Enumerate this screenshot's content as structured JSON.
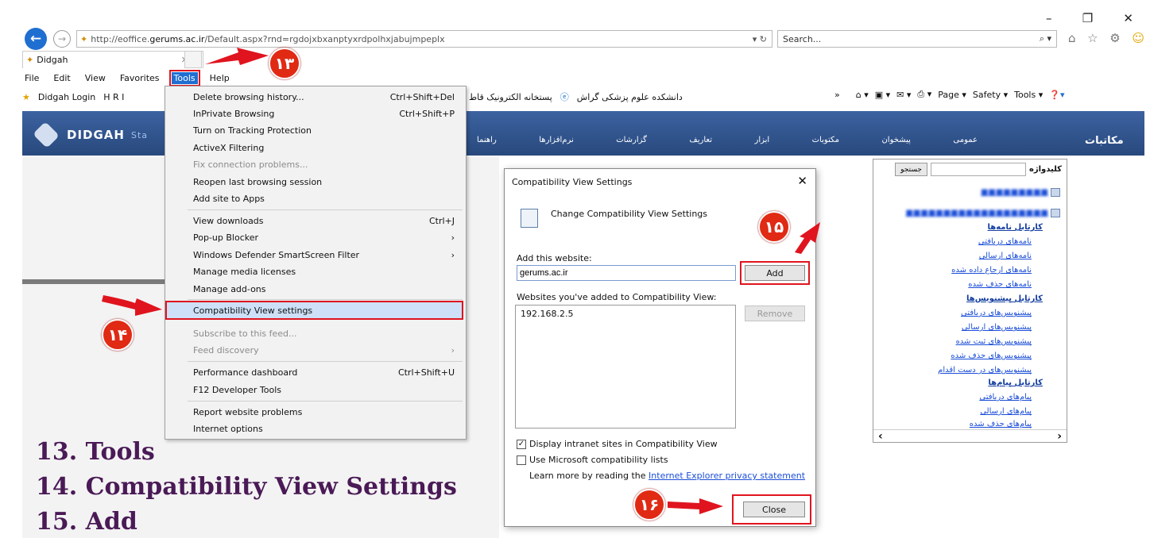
{
  "browser": {
    "url_prefix": "http://eoffice.",
    "url_domain": "gerums.ac.ir",
    "url_rest": "/Default.aspx?rnd=rgdojxbxanptyxrdpolhxjabujmpeplx",
    "search_placeholder": "Search...",
    "tab_title": "Didgah",
    "menu": [
      "File",
      "Edit",
      "View",
      "Favorites",
      "Tools",
      "Help"
    ],
    "favorites": [
      "Didgah Login",
      "H R I"
    ],
    "fav_right": "دانشکده علوم پزشکی گراش",
    "fav_right2": "پستخانه الکترونیک قاط",
    "cmd": [
      "Page ▾",
      "Safety ▾",
      "Tools ▾"
    ]
  },
  "page": {
    "logo": "DIDGAH",
    "logo_suffix": "Sta",
    "nav": [
      "عمومی",
      "پیشخوان",
      "مکتوبات",
      "ابزار",
      "تعاریف",
      "گزارشات",
      "نرم‌افزارها",
      "راهنما"
    ],
    "right_title": "مکاتبات",
    "tree": {
      "keyword_label": "کلیدواژه",
      "search_btn": "جستجو",
      "nodes": [
        {
          "label": "کارتابل نامه‌ها",
          "bold": true
        },
        {
          "label": "نامه‌های دریافتی"
        },
        {
          "label": "نامه‌های ارسالی"
        },
        {
          "label": "نامه‌های ارجاع داده شده"
        },
        {
          "label": "نامه‌های حذف شده"
        },
        {
          "label": "کارتابل پیشنویس‌ها",
          "bold": true
        },
        {
          "label": "پیشنویس‌های دریافتی"
        },
        {
          "label": "پیشنویس‌های ارسالی"
        },
        {
          "label": "پیشنویس‌های ثبت شده"
        },
        {
          "label": "پیشنویس‌های حذف شده"
        },
        {
          "label": "پیشنویس‌های در دست اقدام"
        },
        {
          "label": "کارتابل پیام‌ها",
          "bold": true
        },
        {
          "label": "پیام‌های دریافتی"
        },
        {
          "label": "پیام‌های ارسالی"
        },
        {
          "label": "پیام‌های حذف شده"
        }
      ]
    }
  },
  "tools_menu": [
    {
      "label": "Delete browsing history...",
      "shortcut": "Ctrl+Shift+Del"
    },
    {
      "label": "InPrivate Browsing",
      "shortcut": "Ctrl+Shift+P"
    },
    {
      "label": "Turn on Tracking Protection",
      "shortcut": ""
    },
    {
      "label": "ActiveX Filtering",
      "shortcut": ""
    },
    {
      "label": "Fix connection problems...",
      "shortcut": "",
      "disabled": true
    },
    {
      "label": "Reopen last browsing session",
      "shortcut": ""
    },
    {
      "label": "Add site to Apps",
      "shortcut": ""
    },
    {
      "label": "View downloads",
      "shortcut": "Ctrl+J"
    },
    {
      "label": "Pop-up Blocker",
      "shortcut": "›"
    },
    {
      "label": "Windows Defender SmartScreen Filter",
      "shortcut": "›"
    },
    {
      "label": "Manage media licenses",
      "shortcut": ""
    },
    {
      "label": "Manage add-ons",
      "shortcut": ""
    },
    {
      "label": "Compatibility View settings",
      "shortcut": ""
    },
    {
      "label": "Subscribe to this feed...",
      "shortcut": "",
      "disabled": true
    },
    {
      "label": "Feed discovery",
      "shortcut": "›",
      "disabled": true
    },
    {
      "label": "Performance dashboard",
      "shortcut": "Ctrl+Shift+U"
    },
    {
      "label": "F12 Developer Tools",
      "shortcut": ""
    },
    {
      "label": "Report website problems",
      "shortcut": ""
    },
    {
      "label": "Internet options",
      "shortcut": ""
    }
  ],
  "dialog": {
    "title": "Compatibility View Settings",
    "heading": "Change Compatibility View Settings",
    "add_label": "Add this website:",
    "add_value": "gerums.ac.ir",
    "add_btn": "Add",
    "list_label": "Websites you've added to Compatibility View:",
    "list_items": [
      "192.168.2.5"
    ],
    "remove_btn": "Remove",
    "cb1": "Display intranet sites in Compatibility View",
    "cb2": "Use Microsoft compatibility lists",
    "learn_prefix": "Learn more by reading the ",
    "learn_link": "Internet Explorer privacy statement",
    "close_btn": "Close"
  },
  "annotations": {
    "badges": [
      "۱۳",
      "۱۴",
      "۱۵",
      "۱۶"
    ],
    "steps": [
      "13. Tools",
      "14. Compatibility View Settings",
      "15. Add"
    ]
  }
}
